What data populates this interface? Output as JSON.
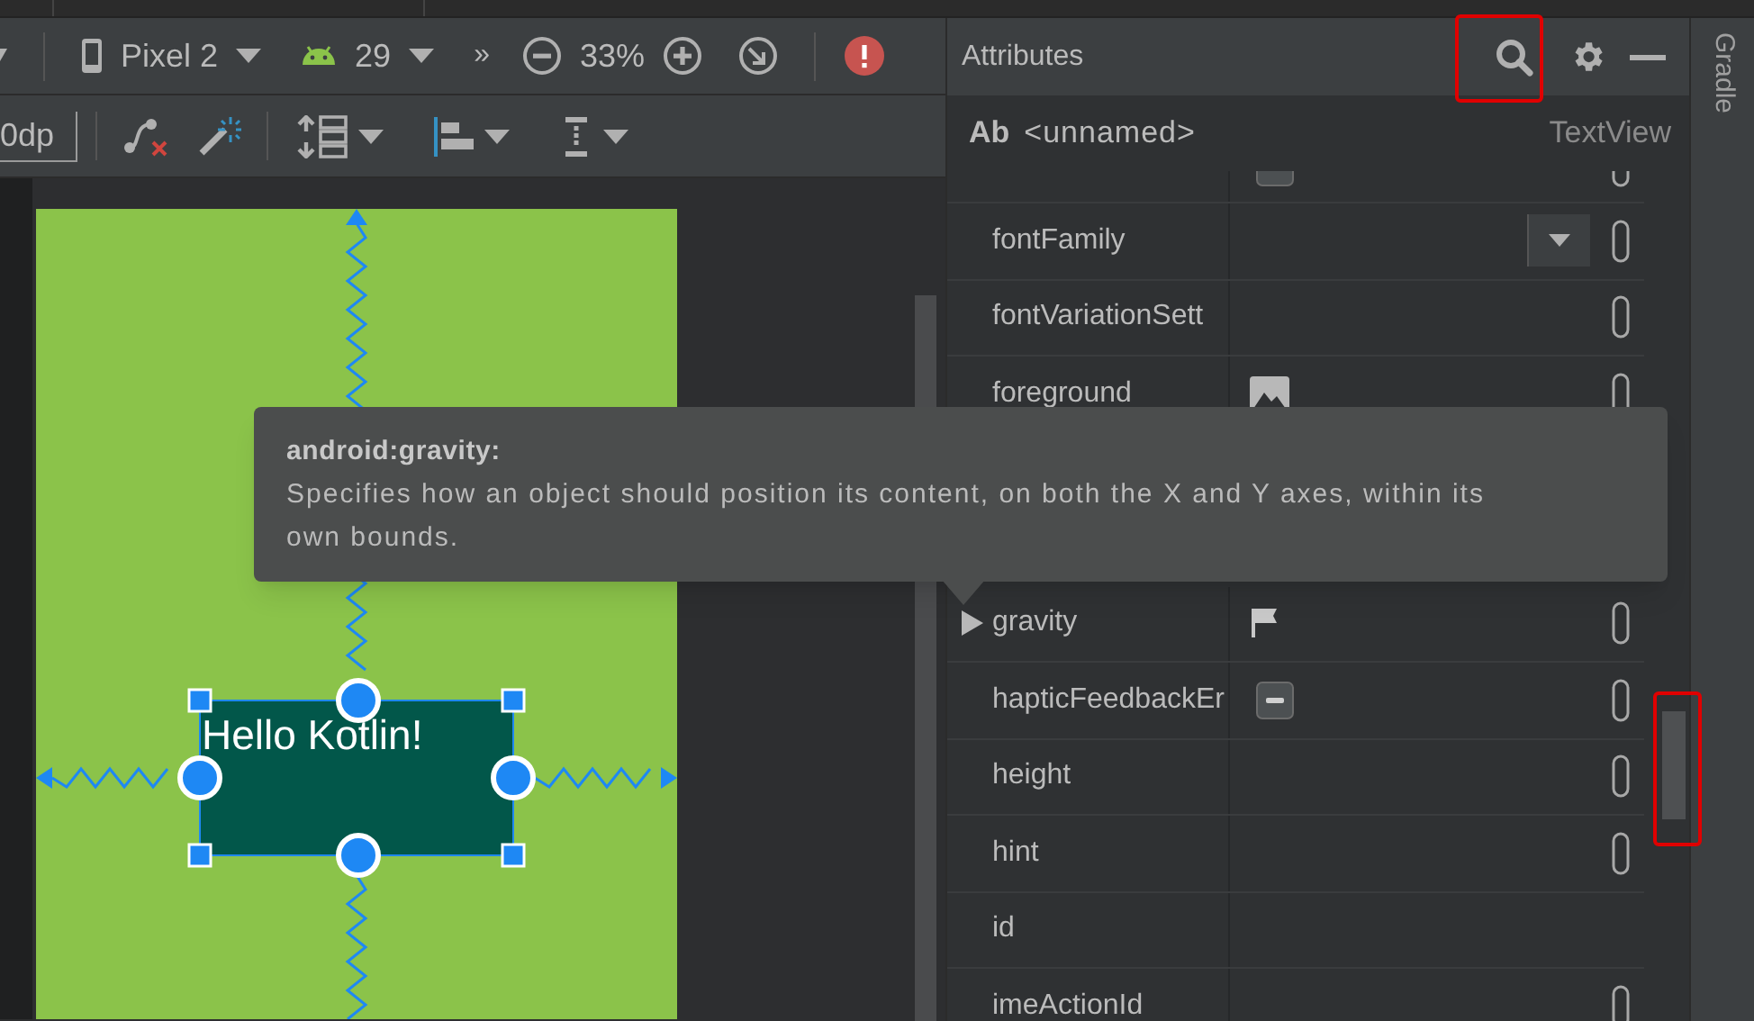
{
  "toolbar": {
    "device": "Pixel 2",
    "api_level": "29",
    "overflow": "»",
    "zoom": "33%"
  },
  "toolbar2": {
    "margin": "0dp"
  },
  "canvas": {
    "text_view": "Hello Kotlin!"
  },
  "tooltip": {
    "title": "android:gravity:",
    "body": "Specifies how an object should position its content, on both the X and Y axes, within its own bounds."
  },
  "attributes_panel": {
    "title": "Attributes",
    "component": {
      "icon_text": "Ab",
      "name": "<unnamed>",
      "type": "TextView"
    },
    "rows": [
      {
        "kind": "checkbox",
        "checked": false,
        "picker": true,
        "expandable": false
      },
      {
        "name": "fontFamily",
        "kind": "dropdown",
        "picker": true,
        "expandable": false
      },
      {
        "name": "fontVariationSett",
        "kind": "text",
        "picker": true,
        "expandable": false
      },
      {
        "name": "foreground",
        "kind": "image",
        "picker": true,
        "expandable": false
      },
      {
        "name": "gravity",
        "kind": "flag",
        "picker": true,
        "expandable": true
      },
      {
        "name": "hapticFeedbackEr",
        "kind": "checkbox",
        "checked": false,
        "indeterminate": true,
        "picker": true,
        "expandable": false
      },
      {
        "name": "height",
        "kind": "text",
        "picker": true,
        "expandable": false
      },
      {
        "name": "hint",
        "kind": "text",
        "picker": true,
        "expandable": false
      },
      {
        "name": "id",
        "kind": "text",
        "picker": false,
        "expandable": false
      },
      {
        "name": "imeActionId",
        "kind": "text",
        "picker": true,
        "expandable": false
      }
    ]
  },
  "side_tab": "Gradle"
}
